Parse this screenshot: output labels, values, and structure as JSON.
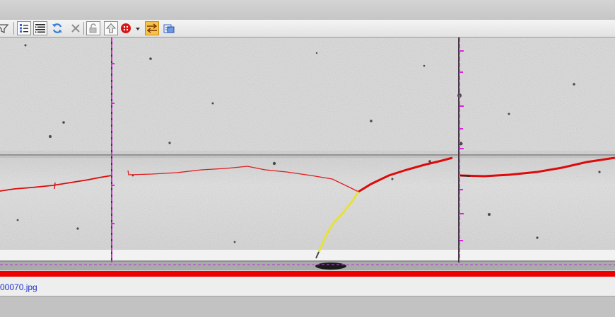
{
  "toolbar": {
    "buttons": [
      {
        "name": "filter-icon",
        "enabled": true
      },
      {
        "name": "list-view-icon",
        "enabled": true
      },
      {
        "name": "indent-list-icon",
        "enabled": true
      },
      {
        "name": "refresh-icon",
        "enabled": true
      },
      {
        "name": "close-icon",
        "enabled": false
      },
      {
        "name": "unlock-icon",
        "enabled": false
      },
      {
        "name": "arrow-up-icon",
        "enabled": true
      },
      {
        "name": "record-red-icon",
        "enabled": true
      },
      {
        "name": "swap-arrows-icon",
        "enabled": true,
        "active": true
      },
      {
        "name": "export-icon",
        "enabled": true
      }
    ]
  },
  "colors": {
    "crack_major": "#dd0a0a",
    "crack_minor": "#e01c1c",
    "crack_branch": "#e6e23a",
    "joint_marker": "#e11ee6",
    "bottom_band": "#ee0000",
    "accent_toggle": "#f6c24a"
  },
  "status": {
    "filename": "00070.jpg"
  }
}
